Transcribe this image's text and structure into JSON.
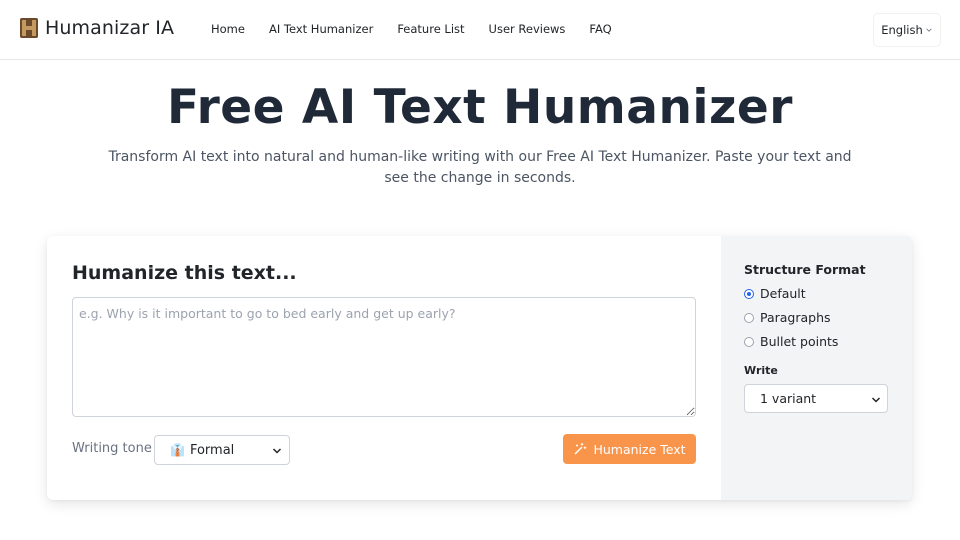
{
  "header": {
    "brand": "Humanizar IA",
    "nav": [
      "Home",
      "AI Text Humanizer",
      "Feature List",
      "User Reviews",
      "FAQ"
    ],
    "language": "English"
  },
  "hero": {
    "title": "Free AI Text Humanizer",
    "subtitle": "Transform AI text into natural and human-like writing with our Free AI Text Humanizer. Paste your text and see the change in seconds."
  },
  "editor": {
    "title": "Humanize this text...",
    "value": "",
    "placeholder": "e.g. Why is it important to go to bed early and get up early?",
    "tone_label": "Writing tone",
    "tone_icon": "👔",
    "tone_value": "Formal",
    "button_label": "Humanize Text"
  },
  "options": {
    "structure_title": "Structure Format",
    "structure": [
      {
        "label": "Default",
        "checked": true
      },
      {
        "label": "Paragraphs",
        "checked": false
      },
      {
        "label": "Bullet points",
        "checked": false
      }
    ],
    "write_label": "Write",
    "variant_value": "1 variant"
  },
  "colors": {
    "accent": "#f8954b",
    "radio_selected": "#2563eb",
    "panel_bg": "#f3f4f6"
  }
}
